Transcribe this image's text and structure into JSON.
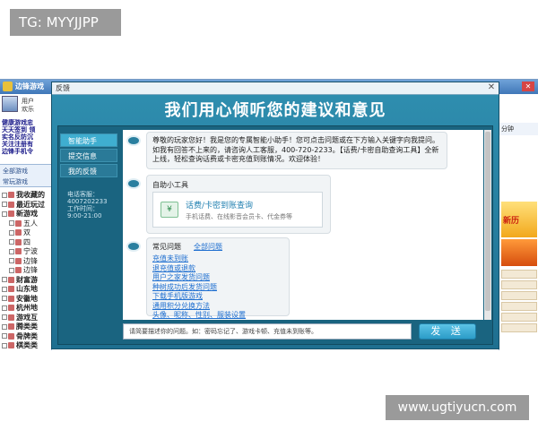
{
  "watermark": {
    "top_left": "TG: MYYJJPP",
    "bottom_right": "www.ugtiyucn.com"
  },
  "app": {
    "title": "边锋游戏",
    "close_glyph": "✕",
    "user_lines": [
      "用户",
      "欢乐"
    ],
    "quick_links": [
      "健康游戏忠",
      "天天签到 领",
      "实名反防沉",
      "关注注册有",
      "边锋手机令"
    ],
    "category_tabs": [
      "全部游戏",
      "常玩游戏"
    ],
    "tree": [
      {
        "label": "我收藏的",
        "bold": true
      },
      {
        "label": "最近玩过",
        "bold": true
      },
      {
        "label": "新游戏",
        "bold": true
      },
      {
        "label": "五人",
        "bold": false
      },
      {
        "label": "双",
        "bold": false
      },
      {
        "label": "四",
        "bold": false
      },
      {
        "label": "宁波",
        "bold": false
      },
      {
        "label": "边锋",
        "bold": false
      },
      {
        "label": "边锋",
        "bold": false
      },
      {
        "label": "财富游",
        "bold": true
      },
      {
        "label": "山东地",
        "bold": true
      },
      {
        "label": "安徽地",
        "bold": true
      },
      {
        "label": "杭州地",
        "bold": true
      },
      {
        "label": "游戏互",
        "bold": true
      },
      {
        "label": "腾类类",
        "bold": true
      },
      {
        "label": "骨牌类",
        "bold": true
      },
      {
        "label": "棋类类",
        "bold": true
      }
    ],
    "right": {
      "top_label": "分钟",
      "ad_text": "新历"
    }
  },
  "dialog": {
    "title": "反馈",
    "close_glyph": "✕",
    "banner": "我们用心倾听您的建议和意见",
    "nav": [
      "智能助手",
      "提交信息",
      "我的反馈"
    ],
    "hotline": {
      "label": "电话客服：",
      "number": "4007202233",
      "hours_label": "工作时间：",
      "hours": "9:00-21:00"
    },
    "greeting": "尊敬的玩家您好！我是您的专属智能小助手！您可点击问题或在下方输入关键字向我提问。如我有回答不上来的，请咨询人工客服，400-720-2233。【话费/卡密自助查询工具】全新上线，轻松查询话费或卡密充值到账情况。欢迎体验！",
    "tools": {
      "title": "自助小工具",
      "card_name": "话费/卡密到账查询",
      "card_desc": "手机话费、在线影音会员卡、代金券等",
      "icon_glyph": "¥"
    },
    "faq": {
      "heading": "常见问题",
      "all_link": "全部问题",
      "items": [
        "充值未到账",
        "退充值或退款",
        "用户之家发货问题",
        "种树成功后发货问题",
        "下载手机版游戏",
        "通用积分兑换方法",
        "头像、昵称、性别、服装设置"
      ]
    },
    "input_placeholder": "请简要描述你的问题。如：密码忘记了、游戏卡顿、充值未到账等。",
    "send_label": "发 送"
  }
}
